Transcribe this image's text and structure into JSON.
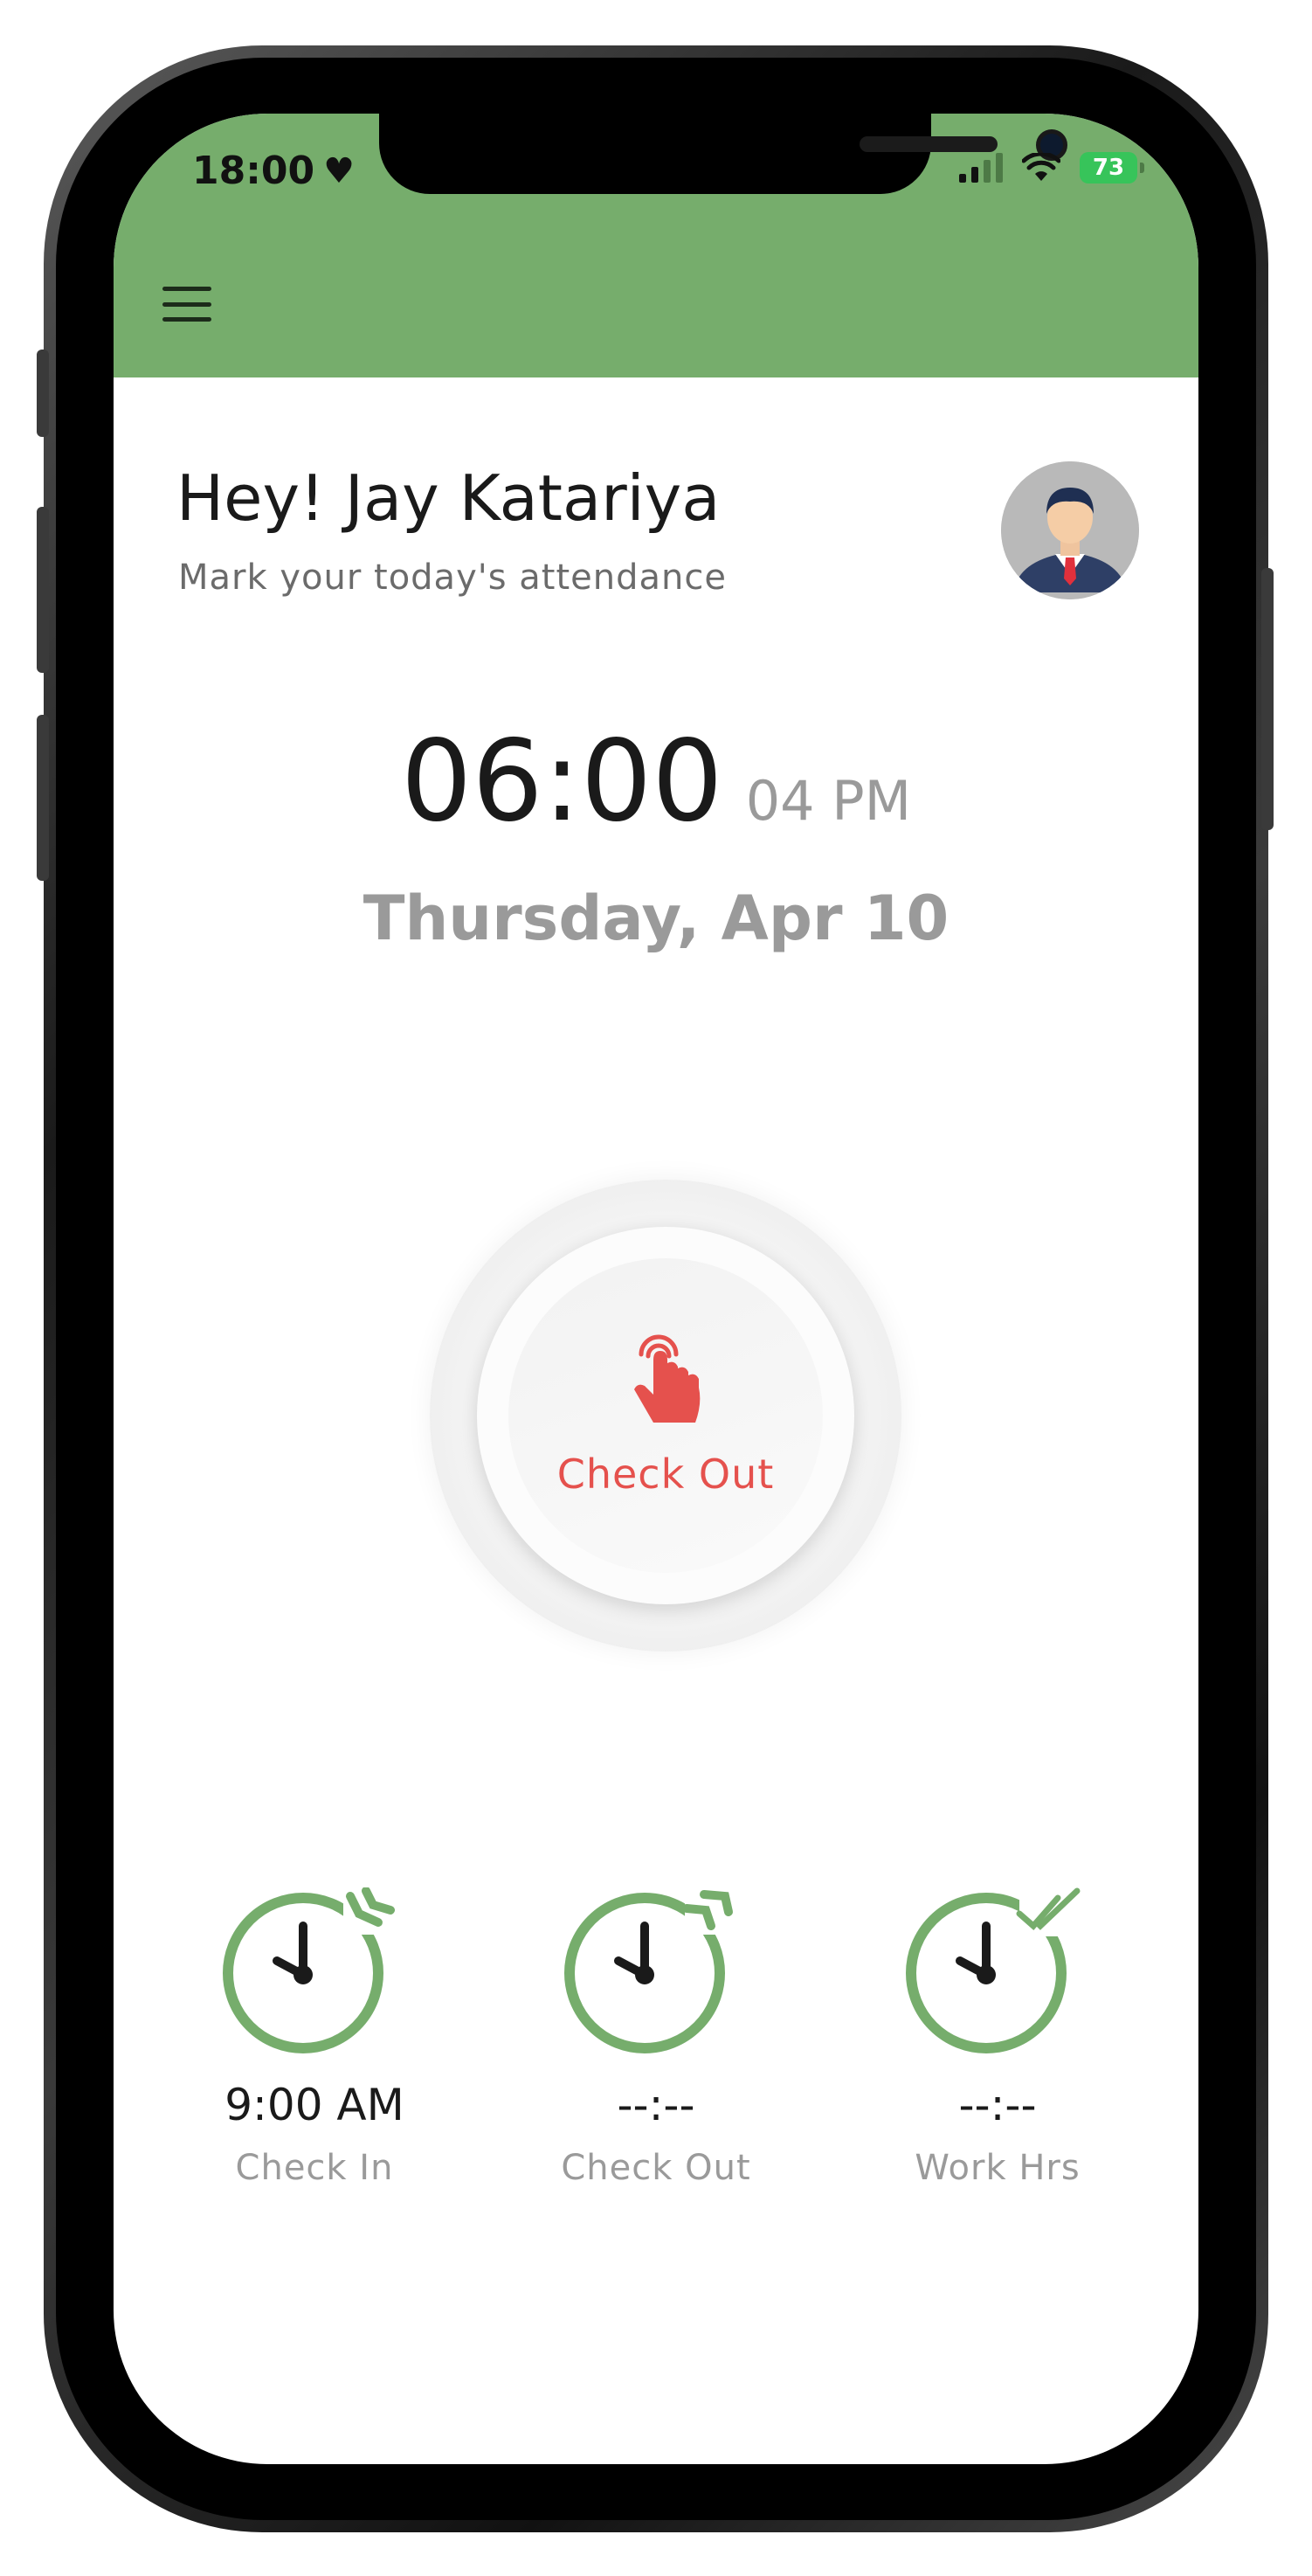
{
  "status_bar": {
    "time": "18:00",
    "battery": "73"
  },
  "header": {
    "greeting": "Hey! Jay Katariya",
    "subtitle": "Mark your today's attendance"
  },
  "clock": {
    "time": "06:00",
    "ampm": "04 PM",
    "date": "Thursday, Apr 10"
  },
  "action_button": {
    "label": "Check Out"
  },
  "stats": [
    {
      "value": "9:00 AM",
      "label": "Check In"
    },
    {
      "value": "--:--",
      "label": "Check Out"
    },
    {
      "value": "--:--",
      "label": "Work Hrs"
    }
  ],
  "colors": {
    "accent_green": "#76ad6c",
    "checkout_red": "#e5514d",
    "text_dark": "#1a1a1a",
    "text_muted": "#9a9a9a"
  },
  "icons": {
    "menu": "hamburger-icon",
    "tap": "tap-hand-icon",
    "clock": "clock-icon"
  }
}
